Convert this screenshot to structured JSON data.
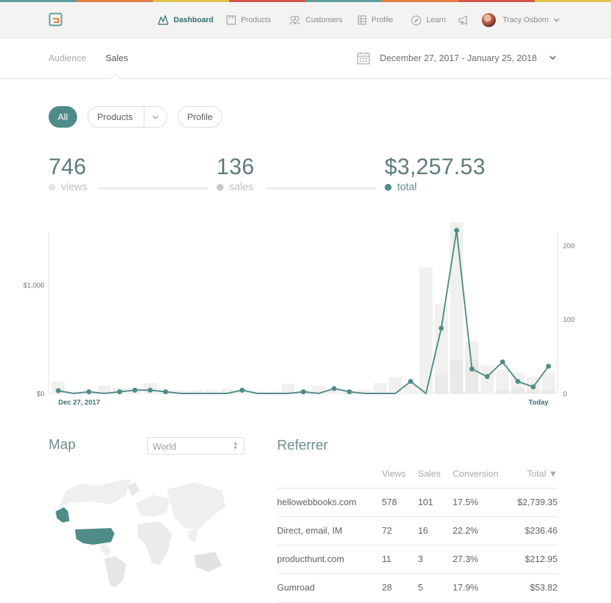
{
  "brand_stripe": [
    "#5a9e9a",
    "#e57c44",
    "#e0c44a",
    "#d6534a",
    "#5a9e9a",
    "#e57c44",
    "#d6534a",
    "#e0c44a"
  ],
  "nav": {
    "items": [
      {
        "label": "Dashboard",
        "icon": "dashboard-icon",
        "active": true
      },
      {
        "label": "Products",
        "icon": "products-icon",
        "active": false
      },
      {
        "label": "Customers",
        "icon": "customers-icon",
        "active": false
      },
      {
        "label": "Profile",
        "icon": "profile-icon",
        "active": false
      },
      {
        "label": "Learn",
        "icon": "learn-icon",
        "active": false
      }
    ],
    "announcements_icon": "megaphone-icon",
    "user_name": "Tracy Osborn"
  },
  "subnav": {
    "tabs": [
      {
        "label": "Audience",
        "active": false
      },
      {
        "label": "Sales",
        "active": true
      }
    ],
    "date_range": "December 27, 2017 - January 25, 2018"
  },
  "filters": {
    "all": "All",
    "products": "Products",
    "profile": "Profile"
  },
  "stats": {
    "views": {
      "value": "746",
      "label": "views",
      "color": "#e6e6e6"
    },
    "sales": {
      "value": "136",
      "label": "sales",
      "color": "#c9c9c9"
    },
    "total": {
      "value": "$3,257.53",
      "label": "total",
      "color": "#4f8c89"
    }
  },
  "chart_data": {
    "type": "line",
    "x_start_label": "Dec 27, 2017",
    "x_end_label": "Today",
    "left_axis": {
      "ticks": [
        "$0",
        "$1,000"
      ],
      "ylim": [
        0,
        1500
      ]
    },
    "right_axis": {
      "ticks": [
        "0",
        "100",
        "200"
      ],
      "ylim": [
        0,
        220
      ]
    },
    "series": [
      {
        "type": "line",
        "axis": "left",
        "color": "#4f8c89",
        "values": [
          25,
          0,
          15,
          0,
          15,
          30,
          30,
          15,
          0,
          0,
          0,
          0,
          30,
          0,
          0,
          0,
          15,
          0,
          45,
          15,
          0,
          0,
          0,
          110,
          0,
          600,
          1500,
          225,
          155,
          290,
          110,
          60,
          250
        ]
      },
      {
        "type": "bar",
        "axis": "right",
        "color": "#f0f0ee",
        "values": [
          16,
          3,
          2,
          10,
          8,
          8,
          14,
          4,
          4,
          4,
          5,
          6,
          3,
          3,
          3,
          13,
          4,
          10,
          6,
          5,
          5,
          14,
          22,
          12,
          170,
          120,
          240,
          70,
          38,
          32,
          28,
          22,
          28
        ]
      },
      {
        "type": "bar",
        "axis": "right",
        "color": "#e9e9e7",
        "values": [
          0,
          0,
          0,
          0,
          0,
          0,
          0,
          0,
          0,
          0,
          0,
          0,
          0,
          0,
          0,
          0,
          0,
          0,
          0,
          0,
          0,
          0,
          0,
          0,
          0,
          25,
          45,
          45,
          0,
          5,
          6,
          5,
          5
        ]
      }
    ]
  },
  "map": {
    "title": "Map",
    "region": "World",
    "highlight_color": "#4f8c89"
  },
  "referrer": {
    "title": "Referrer",
    "columns": [
      "",
      "Views",
      "Sales",
      "Conversion",
      "Total ▼"
    ],
    "rows": [
      [
        "hellowebbooks.com",
        "578",
        "101",
        "17.5%",
        "$2,739.35"
      ],
      [
        "Direct, email, IM",
        "72",
        "16",
        "22.2%",
        "$236.46"
      ],
      [
        "producthunt.com",
        "11",
        "3",
        "27.3%",
        "$212.95"
      ],
      [
        "Gumroad",
        "28",
        "5",
        "17.9%",
        "$53.82"
      ]
    ]
  }
}
